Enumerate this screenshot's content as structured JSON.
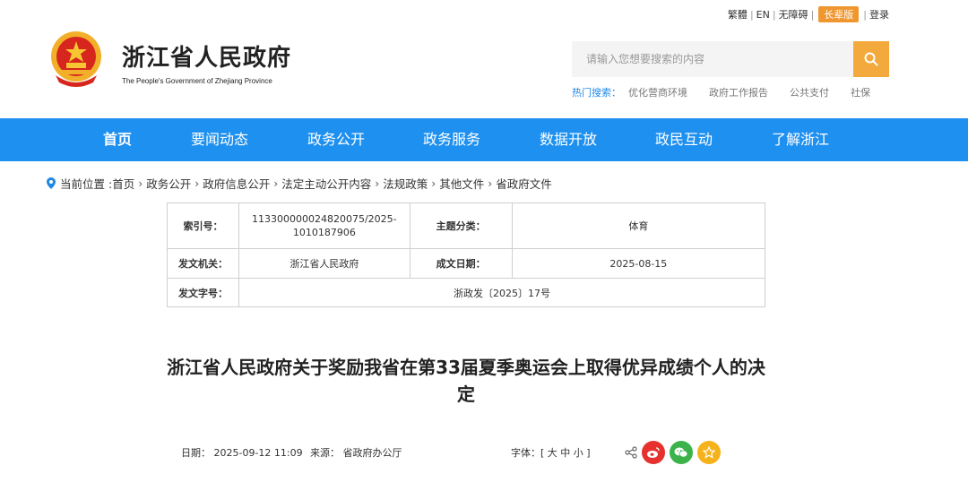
{
  "header": {
    "site_title": "浙江省人民政府",
    "site_subtitle": "The People's Government of Zhejiang Province",
    "top_links": [
      "繁體",
      "EN",
      "无障碍",
      "长辈版",
      "登录"
    ]
  },
  "search": {
    "placeholder": "请输入您想要搜索的内容",
    "hot_label": "热门搜索：",
    "hot_items": [
      "优化营商环境",
      "政府工作报告",
      "公共支付",
      "社保"
    ]
  },
  "nav": {
    "items": [
      "首页",
      "要闻动态",
      "政务公开",
      "政务服务",
      "数据开放",
      "政民互动",
      "了解浙江"
    ]
  },
  "breadcrumb": {
    "prefix": "当前位置 :",
    "items": [
      "首页",
      "政务公开",
      "政府信息公开",
      "法定主动公开内容",
      "法规政策",
      "其他文件",
      "省政府文件"
    ]
  },
  "meta_table": {
    "index_label": "索引号：",
    "index_value": "113300000024820075/2025-1010187906",
    "topic_label": "主题分类：",
    "topic_value": "体育",
    "issuer_label": "发文机关：",
    "issuer_value": "浙江省人民政府",
    "date_label": "成文日期：",
    "date_value": "2025-08-15",
    "docno_label": "发文字号：",
    "docno_value": "浙政发〔2025〕17号"
  },
  "article": {
    "title": "浙江省人民政府关于奖励我省在第33届夏季奥运会上取得优异成绩个人的决定",
    "date_text": "日期： 2025-09-12 11:09",
    "source_text": "来源： 省政府办公厅",
    "font_text": "字体：[ 大 中 小 ]"
  },
  "colors": {
    "nav_bg": "#1e90f0",
    "accent": "#f3a93b",
    "weibo": "#e6312e",
    "wechat": "#3bb34a",
    "favorite": "#f5b21a"
  }
}
